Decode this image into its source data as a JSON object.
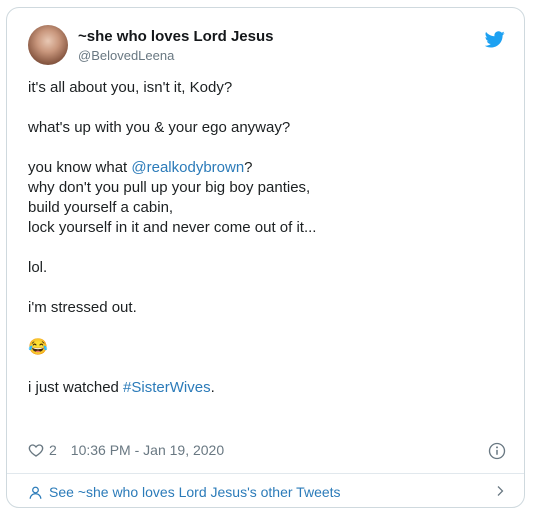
{
  "tweet": {
    "author_name": "~she who loves Lord Jesus",
    "author_handle": "@BelovedLeena",
    "lines": [
      {
        "pre": "it's all about you, isn't it, Kody?"
      },
      {
        "pre": ""
      },
      {
        "pre": "what's up with you & your ego anyway?"
      },
      {
        "pre": ""
      },
      {
        "pre": "you know what ",
        "link": "@realkodybrown",
        "post": "?"
      },
      {
        "pre": "why don't you pull up your big boy panties,"
      },
      {
        "pre": "build yourself a cabin,"
      },
      {
        "pre": "lock yourself in it and never come out of it..."
      },
      {
        "pre": ""
      },
      {
        "pre": "lol."
      },
      {
        "pre": ""
      },
      {
        "pre": "i'm stressed out."
      },
      {
        "pre": ""
      },
      {
        "pre": "😂"
      },
      {
        "pre": ""
      },
      {
        "pre": "i just watched ",
        "link": "#SisterWives",
        "post": "."
      }
    ],
    "like_count": "2",
    "timestamp": "10:36 PM - Jan 19, 2020"
  },
  "footer": {
    "other_tweets_label": "See ~she who loves Lord Jesus's other Tweets"
  },
  "icons": {
    "bird": "twitter-bird-icon",
    "heart": "heart-icon",
    "info": "info-icon",
    "person": "person-icon",
    "chevron": "chevron-right-icon"
  },
  "colors": {
    "link": "#2b7bb9",
    "muted": "#697882",
    "twitter_blue": "#1da1f2"
  }
}
